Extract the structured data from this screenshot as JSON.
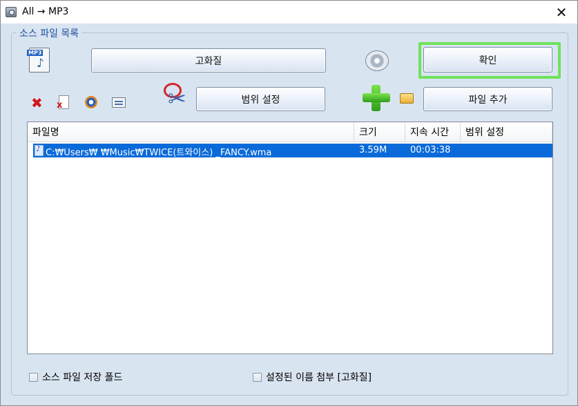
{
  "window": {
    "title": "All → MP3",
    "close_glyph": "✕"
  },
  "group": {
    "legend": "소스 파일 목록"
  },
  "toolbar": {
    "quality_button": "고화질",
    "confirm_button": "확인",
    "range_button": "범위 설정",
    "add_file_button": "파일 추가",
    "mp3_badge": "MP3",
    "delete_glyph": "✖"
  },
  "icons": {
    "mp3_file": "music-file-icon",
    "cd": "cd-drive-icon",
    "delete": "delete-icon",
    "remove_file": "remove-file-icon",
    "play": "play-icon",
    "properties": "properties-icon",
    "cut": "scissors-icon",
    "add": "add-plus-icon",
    "open_folder": "open-folder-icon"
  },
  "file_list": {
    "columns": [
      "파일명",
      "크기",
      "지속 시간",
      "범위 설정"
    ],
    "rows": [
      {
        "path": "C:₩Users₩      ₩Music₩TWICE(트와이스) _FANCY.wma",
        "size": "3.59M",
        "duration": "00:03:38",
        "range": "",
        "selected": true
      }
    ]
  },
  "options": {
    "save_in_source_folder": {
      "label": "소스 파일 저장 폴드",
      "checked": false
    },
    "append_name_suffix": {
      "label": "설정된 이름 첨부 [고화질]",
      "checked": false
    }
  },
  "colors": {
    "dialog_bg": "#d9e4f1",
    "selection": "#0a6ad9",
    "highlight_border": "#6ee35b",
    "legend_text": "#1f4f9a"
  }
}
